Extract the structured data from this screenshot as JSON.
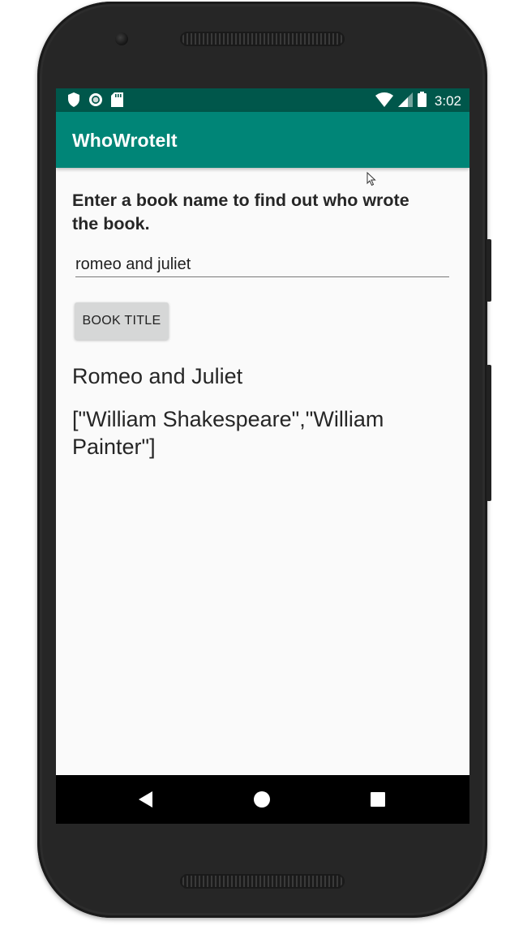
{
  "status_bar": {
    "time": "3:02",
    "left_icons": [
      "shield-icon",
      "circle-notification-icon",
      "sd-card-icon"
    ],
    "right_icons": [
      "wifi-icon",
      "cell-signal-icon",
      "battery-icon"
    ]
  },
  "app_bar": {
    "title": "WhoWroteIt"
  },
  "main": {
    "instructions": "Enter a book name to find out who wrote the book.",
    "search_input": {
      "value": "romeo and juliet",
      "placeholder": ""
    },
    "search_button_label": "BOOK TITLE",
    "result_title": "Romeo and Juliet",
    "result_author": "[\"William Shakespeare\",\"William Painter\"]"
  },
  "nav_bar": {
    "icons": [
      "back-icon",
      "home-icon",
      "recents-icon"
    ]
  },
  "colors": {
    "primary": "#008577",
    "primary_dark": "#00574b",
    "background": "#fafafa",
    "button": "#d6d7d7"
  }
}
